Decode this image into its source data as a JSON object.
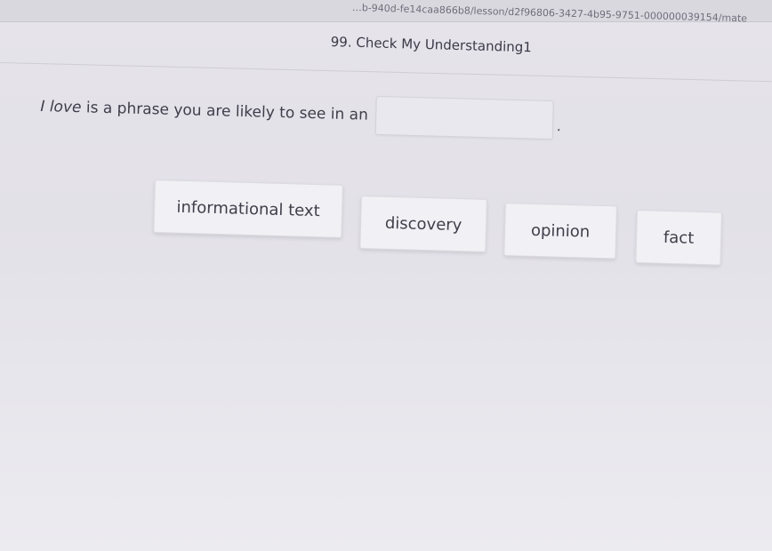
{
  "browser": {
    "url": "…b-940d-fe14caa866b8/lesson/d2f96806-3427-4b95-9751-000000039154/mate"
  },
  "lesson": {
    "title": "99. Check My Understanding1"
  },
  "question": {
    "italic_phrase": "I love",
    "text": " is a phrase you are likely to see in an",
    "blank_value": "",
    "end_punctuation": "."
  },
  "answer_choices": [
    {
      "label": "informational text"
    },
    {
      "label": "discovery"
    },
    {
      "label": "opinion"
    },
    {
      "label": "fact"
    }
  ]
}
